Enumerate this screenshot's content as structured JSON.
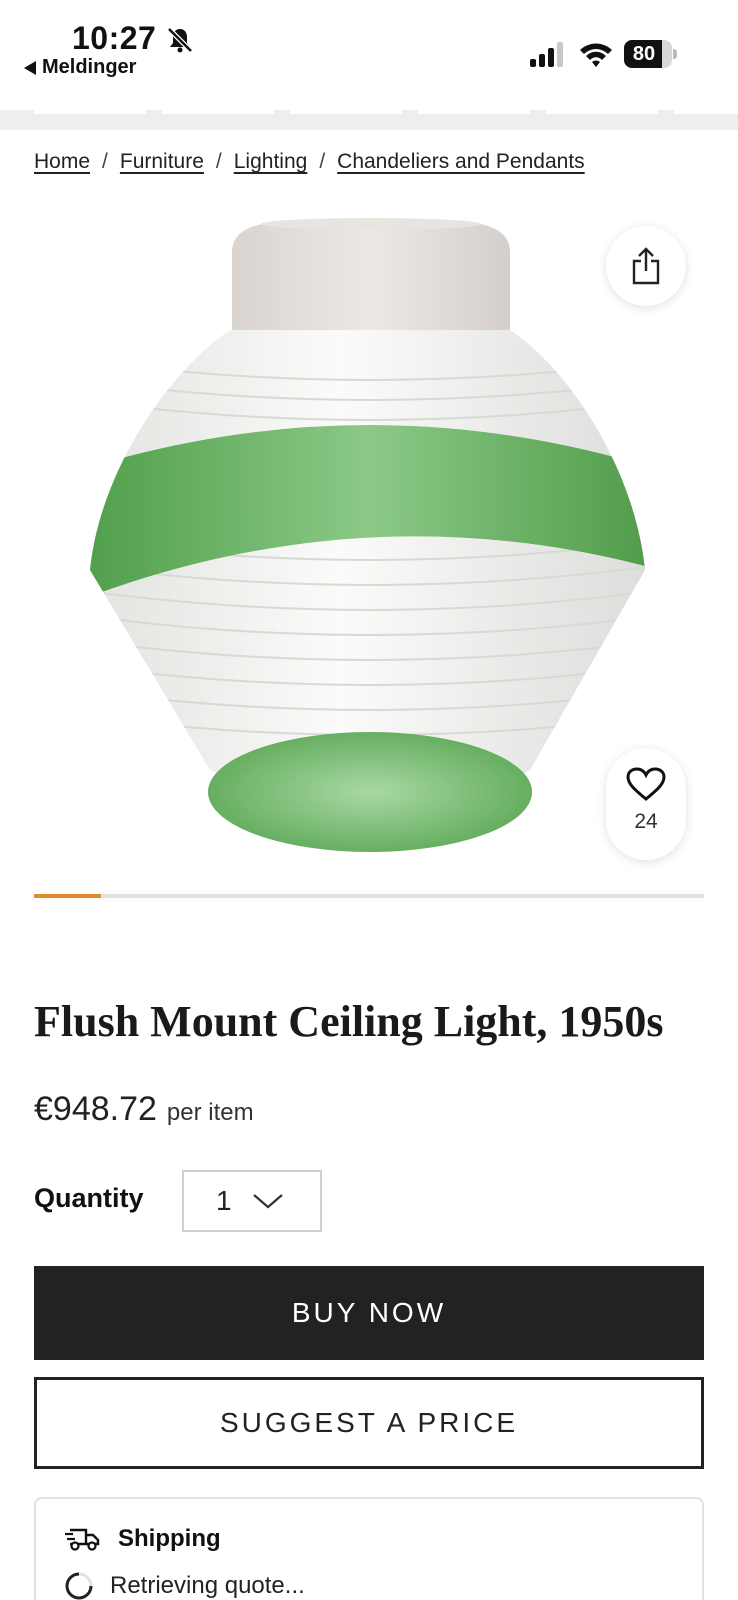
{
  "status_bar": {
    "time": "10:27",
    "back_app": "Meldinger",
    "battery_percent": 80,
    "battery_label": "80"
  },
  "breadcrumb": {
    "items": [
      "Home",
      "Furniture",
      "Lighting",
      "Chandeliers and Pendants"
    ],
    "separator": "/"
  },
  "gallery": {
    "favorites_count": "24",
    "progress_fraction": 0.1,
    "accent_color": "#e3892c"
  },
  "product": {
    "title": "Flush Mount Ceiling Light, 1950s",
    "price": "€948.72",
    "price_unit": "per item",
    "quantity_label": "Quantity",
    "quantity_value": "1"
  },
  "actions": {
    "buy_now": "BUY NOW",
    "suggest_price": "SUGGEST A PRICE"
  },
  "shipping": {
    "title": "Shipping",
    "status": "Retrieving quote..."
  },
  "icons": {
    "bell": "bell-slash-icon",
    "share": "share-icon",
    "favorite": "heart-icon",
    "chevron": "chevron-down-icon",
    "truck": "truck-icon",
    "spinner": "spinner-icon"
  }
}
